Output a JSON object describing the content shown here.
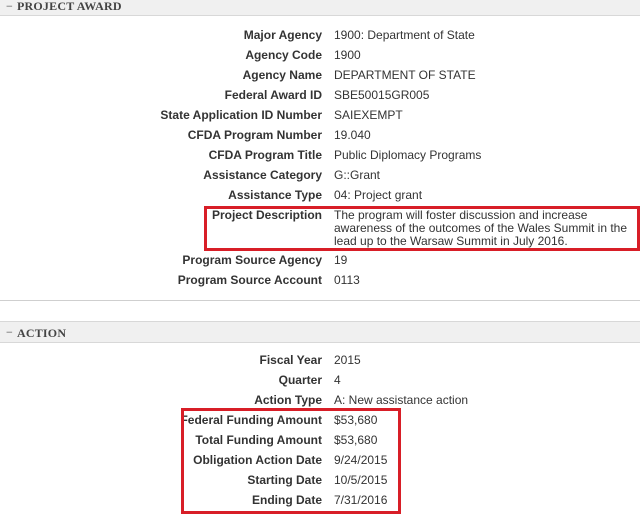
{
  "project_award": {
    "toggle": "−",
    "title": "PROJECT AWARD",
    "rows": [
      {
        "label": "Major Agency",
        "value": "1900: Department of State"
      },
      {
        "label": "Agency Code",
        "value": "1900"
      },
      {
        "label": "Agency Name",
        "value": "DEPARTMENT OF STATE"
      },
      {
        "label": "Federal Award ID",
        "value": "SBE50015GR005"
      },
      {
        "label": "State Application ID Number",
        "value": "SAIEXEMPT"
      },
      {
        "label": "CFDA Program Number",
        "value": "19.040"
      },
      {
        "label": "CFDA Program Title",
        "value": "Public Diplomacy Programs"
      },
      {
        "label": "Assistance Category",
        "value": "G::Grant"
      },
      {
        "label": "Assistance Type",
        "value": "04: Project grant"
      }
    ],
    "description": {
      "label": "Project Description",
      "value": "The program will foster discussion and increase awareness of the outcomes of the Wales Summit in the lead up to the Warsaw Summit in July 2016."
    },
    "rows_after": [
      {
        "label": "Program Source Agency",
        "value": "19"
      },
      {
        "label": "Program Source Account",
        "value": "0113"
      }
    ]
  },
  "action": {
    "toggle": "−",
    "title": "ACTION",
    "rows": [
      {
        "label": "Fiscal Year",
        "value": "2015"
      },
      {
        "label": "Quarter",
        "value": "4"
      },
      {
        "label": "Action Type",
        "value": "A: New assistance action"
      },
      {
        "label": "Federal Funding Amount",
        "value": "$53,680"
      },
      {
        "label": "Total Funding Amount",
        "value": "$53,680"
      },
      {
        "label": "Obligation Action Date",
        "value": "9/24/2015"
      },
      {
        "label": "Starting Date",
        "value": "10/5/2015"
      },
      {
        "label": "Ending Date",
        "value": "7/31/2016"
      }
    ]
  },
  "highlight_color": "#d81e27"
}
